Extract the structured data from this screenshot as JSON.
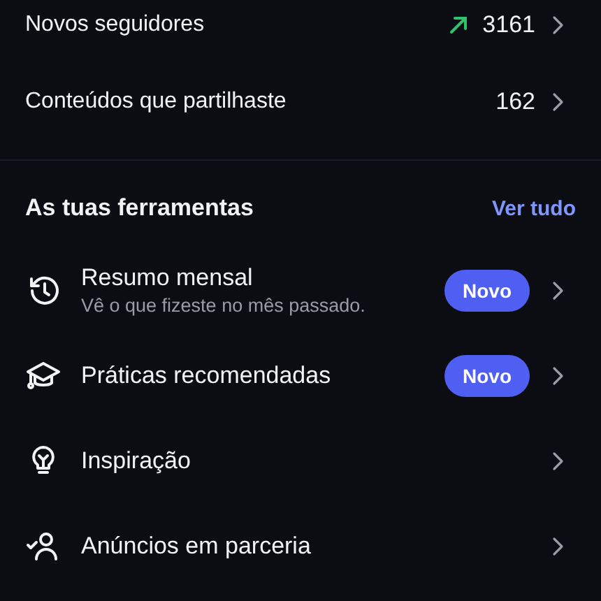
{
  "stats": [
    {
      "label": "Novos seguidores",
      "rising": true,
      "value": "3161"
    },
    {
      "label": "Conteúdos que partilhaste",
      "rising": false,
      "value": "162"
    }
  ],
  "tools_section": {
    "title": "As tuas ferramentas",
    "link": "Ver tudo",
    "items": [
      {
        "title": "Resumo mensal",
        "subtitle": "Vê o que fizeste no mês passado.",
        "badge": "Novo"
      },
      {
        "title": "Práticas recomendadas",
        "badge": "Novo"
      },
      {
        "title": "Inspiração"
      },
      {
        "title": "Anúncios em parceria"
      }
    ]
  }
}
